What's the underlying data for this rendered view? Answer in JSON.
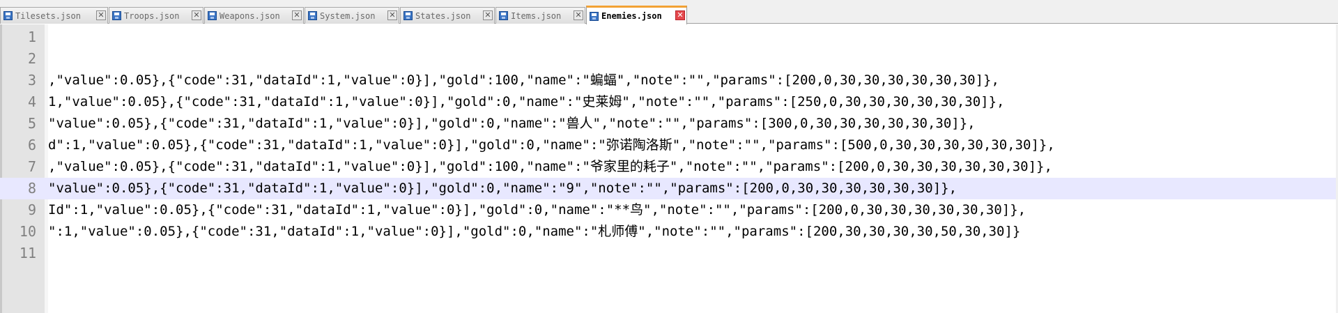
{
  "tabs": [
    {
      "label": "Tilesets.json",
      "active": false
    },
    {
      "label": "Troops.json",
      "active": false
    },
    {
      "label": "Weapons.json",
      "active": false
    },
    {
      "label": "System.json",
      "active": false
    },
    {
      "label": "States.json",
      "active": false
    },
    {
      "label": "Items.json",
      "active": false
    },
    {
      "label": "Enemies.json",
      "active": true
    }
  ],
  "editor": {
    "current_line": 8,
    "lines": [
      {
        "num": "1",
        "text": ""
      },
      {
        "num": "2",
        "text": ""
      },
      {
        "num": "3",
        "text": ",\"value\":0.05},{\"code\":31,\"dataId\":1,\"value\":0}],\"gold\":100,\"name\":\"蝙蝠\",\"note\":\"\",\"params\":[200,0,30,30,30,30,30,30]},"
      },
      {
        "num": "4",
        "text": "1,\"value\":0.05},{\"code\":31,\"dataId\":1,\"value\":0}],\"gold\":0,\"name\":\"史莱姆\",\"note\":\"\",\"params\":[250,0,30,30,30,30,30,30]},"
      },
      {
        "num": "5",
        "text": "\"value\":0.05},{\"code\":31,\"dataId\":1,\"value\":0}],\"gold\":0,\"name\":\"兽人\",\"note\":\"\",\"params\":[300,0,30,30,30,30,30,30]},"
      },
      {
        "num": "6",
        "text": "d\":1,\"value\":0.05},{\"code\":31,\"dataId\":1,\"value\":0}],\"gold\":0,\"name\":\"弥诺陶洛斯\",\"note\":\"\",\"params\":[500,0,30,30,30,30,30,30]},"
      },
      {
        "num": "7",
        "text": ",\"value\":0.05},{\"code\":31,\"dataId\":1,\"value\":0}],\"gold\":100,\"name\":\"爷家里的耗子\",\"note\":\"\",\"params\":[200,0,30,30,30,30,30,30]},"
      },
      {
        "num": "8",
        "text": "\"value\":0.05},{\"code\":31,\"dataId\":1,\"value\":0}],\"gold\":0,\"name\":\"9\",\"note\":\"\",\"params\":[200,0,30,30,30,30,30,30]},"
      },
      {
        "num": "9",
        "text": "Id\":1,\"value\":0.05},{\"code\":31,\"dataId\":1,\"value\":0}],\"gold\":0,\"name\":\"**鸟\",\"note\":\"\",\"params\":[200,0,30,30,30,30,30,30]},"
      },
      {
        "num": "10",
        "text": "\":1,\"value\":0.05},{\"code\":31,\"dataId\":1,\"value\":0}],\"gold\":0,\"name\":\"札师傅\",\"note\":\"\",\"params\":[200,30,30,30,30,50,30,30]}"
      },
      {
        "num": "11",
        "text": ""
      }
    ]
  },
  "colors": {
    "active_tab_accent": "#f2a234",
    "current_line_highlight": "#e8e8ff",
    "gutter": "#e4e4e4"
  },
  "icons": {
    "tab_file": "save-icon",
    "tab_close": "close-icon",
    "close_glyph": "✕"
  }
}
